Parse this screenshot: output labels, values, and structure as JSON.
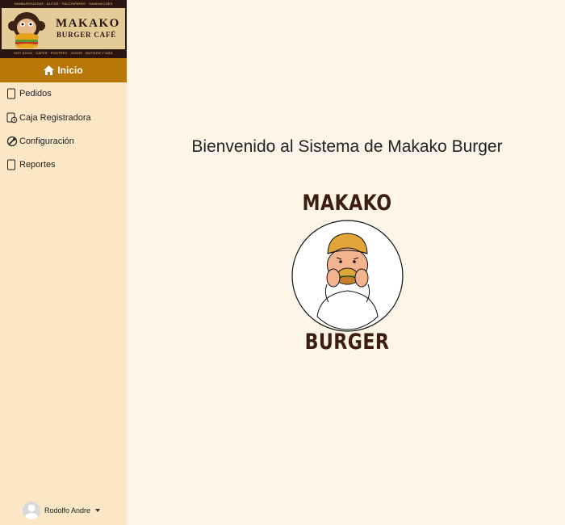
{
  "logo": {
    "top_line": "HAMBURGUESAS · ALITAS · SALCHIPAPAS · SANDWICHES",
    "name_line1": "MAKAKO",
    "name_line2": "BURGER CAFÉ",
    "bottom_line": "HOT DOGS · CAFÉS · POSTRES · JUGOS · BATIDOS Y MÁS"
  },
  "nav": {
    "inicio": "Inicio",
    "items": [
      {
        "label": "Pedidos",
        "icon": "document-icon"
      },
      {
        "label": "Caja Registradora",
        "icon": "cash-register-icon"
      },
      {
        "label": "Configuración",
        "icon": "settings-icon"
      },
      {
        "label": "Reportes",
        "icon": "document-icon"
      }
    ]
  },
  "user": {
    "name": "Rodolfo Andre"
  },
  "main": {
    "welcome": "Bienvenido al Sistema de Makako Burger",
    "brand_top": "MAKAKO",
    "brand_bottom": "BURGER"
  },
  "colors": {
    "accent": "#b87706",
    "sidebar": "#fbe6c6",
    "background": "#fdf5e8",
    "brand": "#3d1d10"
  }
}
